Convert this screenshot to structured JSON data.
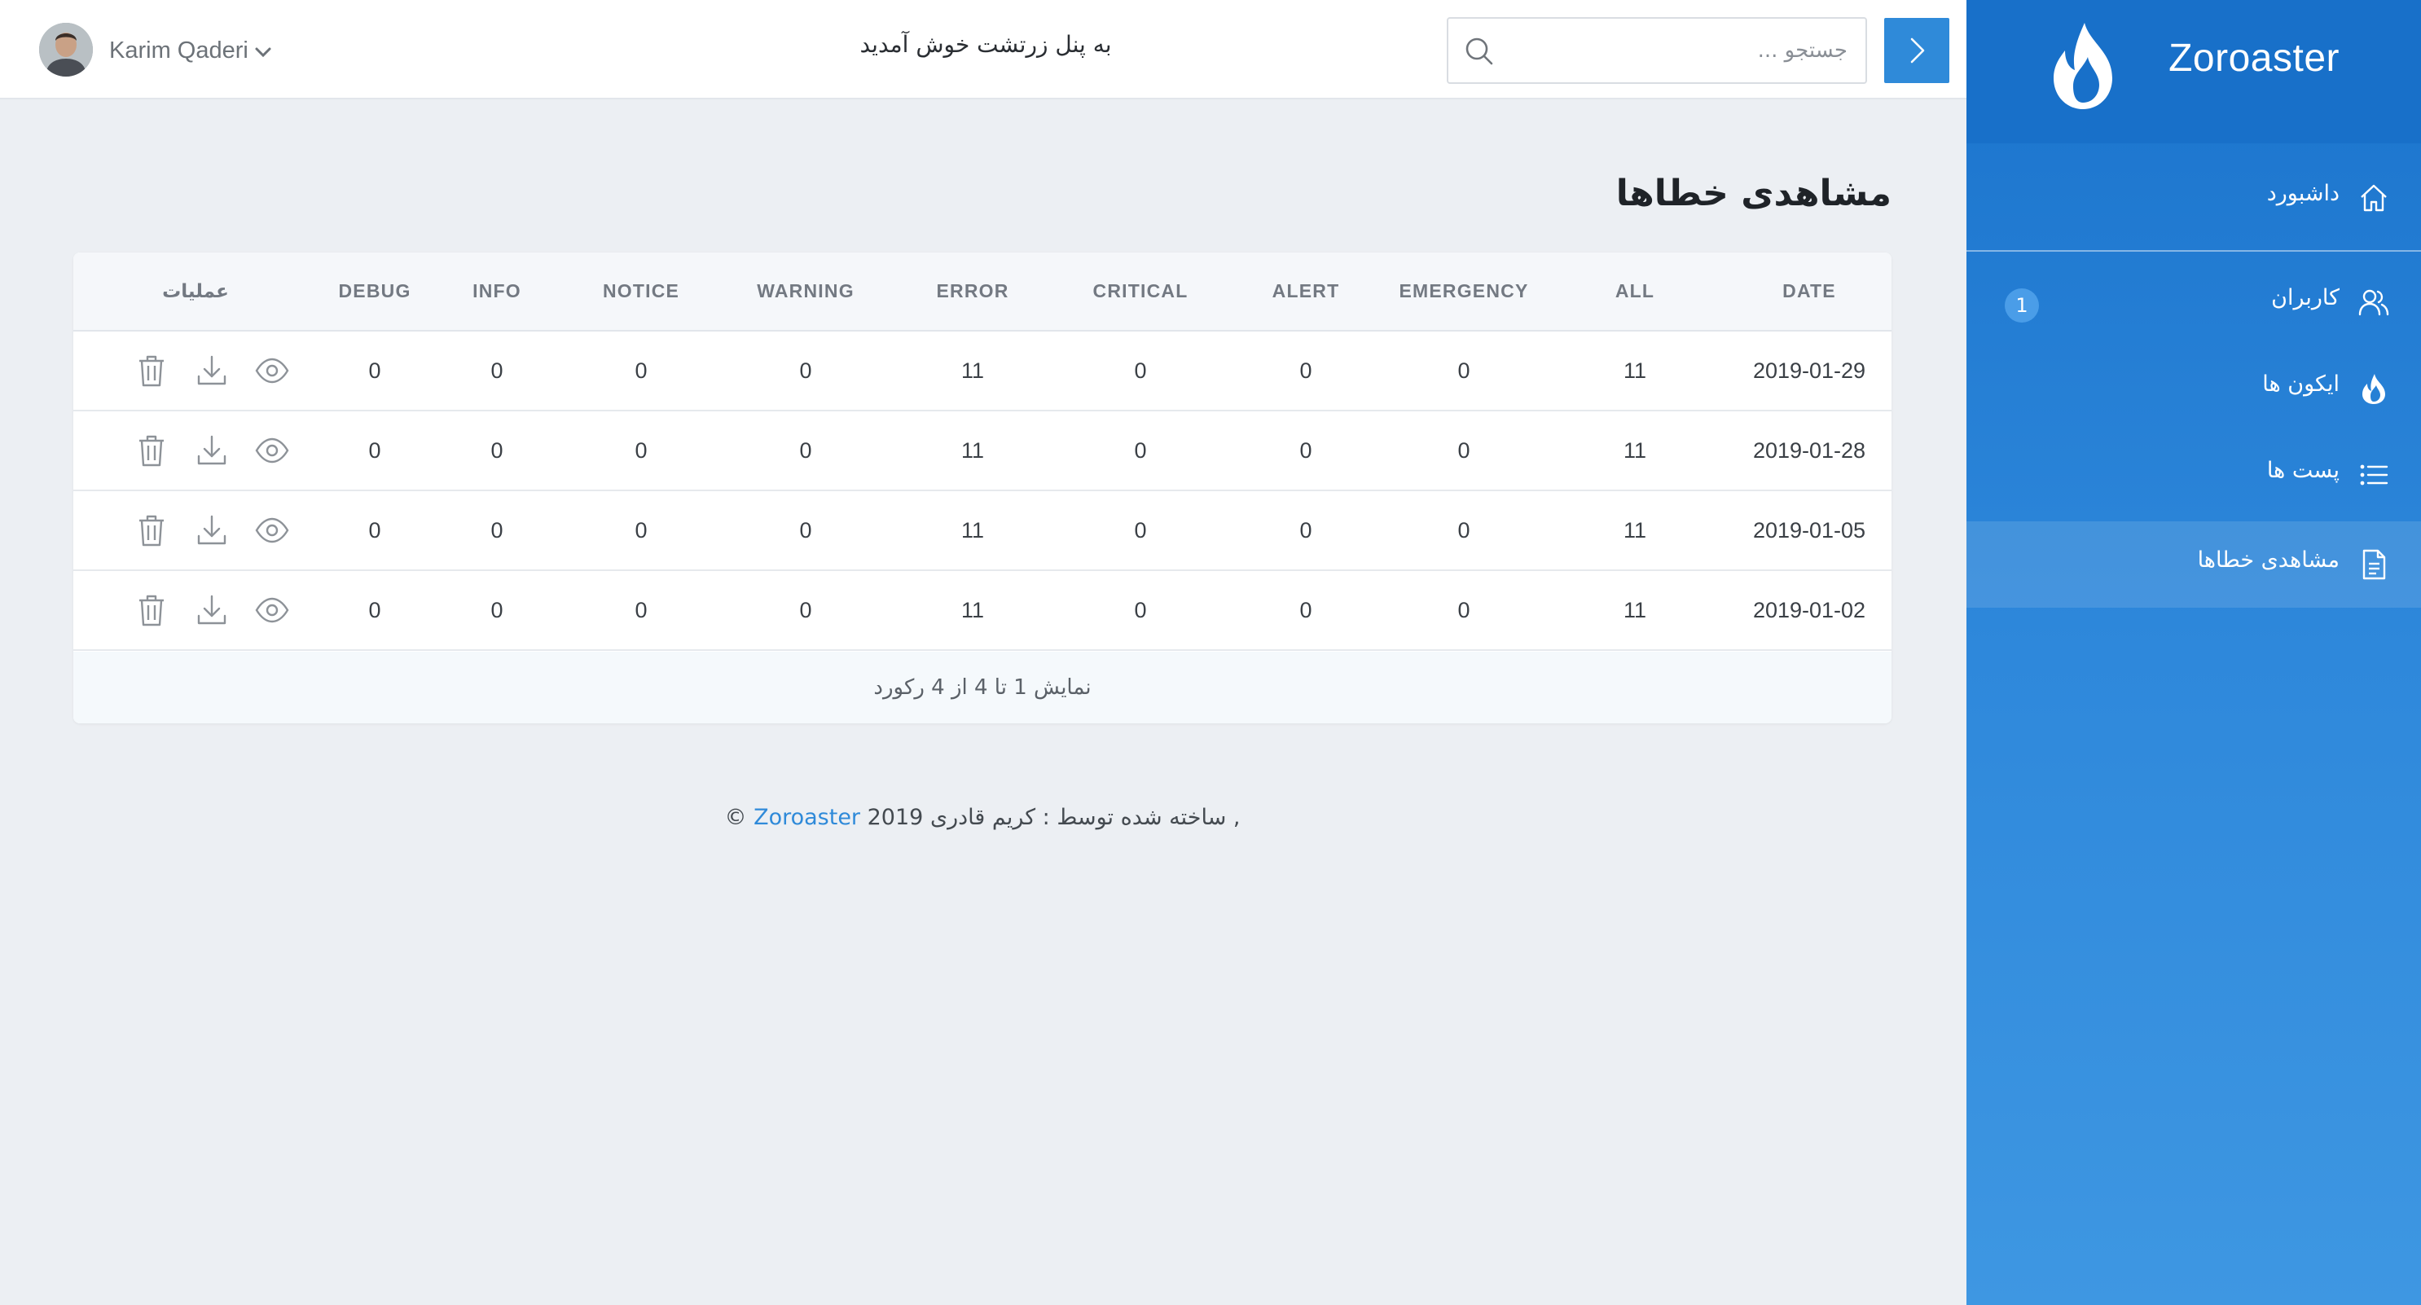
{
  "sidebar": {
    "brand": "Zoroaster",
    "items": [
      {
        "label": "داشبورد",
        "icon": "home-icon"
      },
      {
        "label": "کاربران",
        "icon": "users-icon",
        "badge": "1"
      },
      {
        "label": "ایکون ها",
        "icon": "flame-icon"
      },
      {
        "label": "پست ها",
        "icon": "list-icon"
      },
      {
        "label": "مشاهدی خطاها",
        "icon": "document-icon",
        "active": true
      }
    ]
  },
  "topbar": {
    "search_placeholder": "جستجو ...",
    "welcome": "به پنل زرتشت خوش آمدید",
    "user_name": "Karim Qaderi"
  },
  "page": {
    "title": "مشاهدی خطاها"
  },
  "table": {
    "headers": {
      "date": "DATE",
      "all": "ALL",
      "emergency": "EMERGENCY",
      "alert": "ALERT",
      "critical": "CRITICAL",
      "error": "ERROR",
      "warning": "WARNING",
      "notice": "NOTICE",
      "info": "INFO",
      "debug": "DEBUG",
      "operations": "عملیات"
    },
    "rows": [
      {
        "date": "2019-01-29",
        "all": "11",
        "emergency": "0",
        "alert": "0",
        "critical": "0",
        "error": "11",
        "warning": "0",
        "notice": "0",
        "info": "0",
        "debug": "0"
      },
      {
        "date": "2019-01-28",
        "all": "11",
        "emergency": "0",
        "alert": "0",
        "critical": "0",
        "error": "11",
        "warning": "0",
        "notice": "0",
        "info": "0",
        "debug": "0"
      },
      {
        "date": "2019-01-05",
        "all": "11",
        "emergency": "0",
        "alert": "0",
        "critical": "0",
        "error": "11",
        "warning": "0",
        "notice": "0",
        "info": "0",
        "debug": "0"
      },
      {
        "date": "2019-01-02",
        "all": "11",
        "emergency": "0",
        "alert": "0",
        "critical": "0",
        "error": "11",
        "warning": "0",
        "notice": "0",
        "info": "0",
        "debug": "0"
      }
    ],
    "footer": "نمایش 1 تا 4 از 4 رکورد"
  },
  "footer": {
    "year_text": "2019 ©",
    "brand_link": "Zoroaster",
    "credit": ", ساخته شده توسط : کریم قادری"
  },
  "colors": {
    "sidebar": "#1a73cc",
    "accent": "#2f8ad9",
    "background": "#eceff3"
  }
}
